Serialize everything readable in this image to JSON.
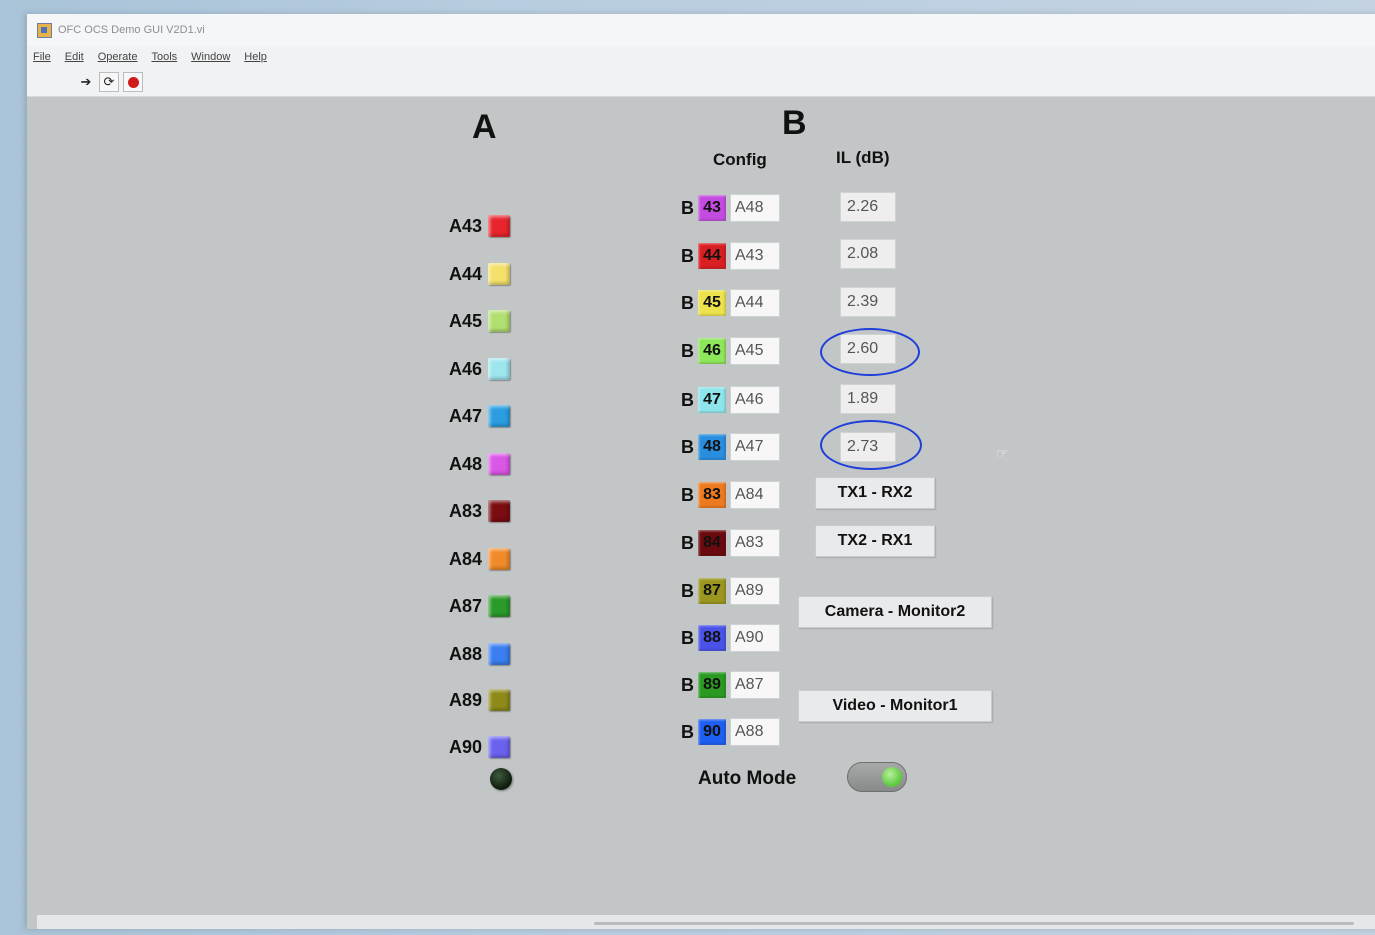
{
  "window": {
    "title": "OFC OCS Demo GUI V2D1.vi",
    "menu": [
      "File",
      "Edit",
      "Operate",
      "Tools",
      "Window",
      "Help"
    ],
    "toolbar": [
      "run-arrow-icon",
      "run-continuously-icon",
      "abort-icon"
    ]
  },
  "headers": {
    "a": "A",
    "b": "B",
    "config": "Config",
    "il": "IL (dB)"
  },
  "a_ports": [
    {
      "label": "A43",
      "color": "#e8242c"
    },
    {
      "label": "A44",
      "color": "#f4e06a"
    },
    {
      "label": "A45",
      "color": "#b2e070"
    },
    {
      "label": "A46",
      "color": "#9ee6ee"
    },
    {
      "label": "A47",
      "color": "#2a9ee0"
    },
    {
      "label": "A48",
      "color": "#da56e6"
    },
    {
      "label": "A83",
      "color": "#7a0c12"
    },
    {
      "label": "A84",
      "color": "#f08a2a"
    },
    {
      "label": "A87",
      "color": "#2a9a2a"
    },
    {
      "label": "A88",
      "color": "#3a7ef0"
    },
    {
      "label": "A89",
      "color": "#8e8a1a"
    },
    {
      "label": "A90",
      "color": "#6a62ee"
    }
  ],
  "b_letter": "B",
  "b_ports": [
    {
      "num": "43",
      "color": "#c34be0",
      "config": "A48"
    },
    {
      "num": "44",
      "color": "#d81f22",
      "config": "A43"
    },
    {
      "num": "45",
      "color": "#ece24c",
      "config": "A44"
    },
    {
      "num": "46",
      "color": "#8ee65a",
      "config": "A45"
    },
    {
      "num": "47",
      "color": "#8ee6ec",
      "config": "A46"
    },
    {
      "num": "48",
      "color": "#2a8ee0",
      "config": "A47"
    },
    {
      "num": "83",
      "color": "#ee7a20",
      "config": "A84"
    },
    {
      "num": "84",
      "color": "#6a0a0e",
      "config": "A83"
    },
    {
      "num": "87",
      "color": "#9a961e",
      "config": "A89"
    },
    {
      "num": "88",
      "color": "#4a52ea",
      "config": "A90"
    },
    {
      "num": "89",
      "color": "#2a9a22",
      "config": "A87"
    },
    {
      "num": "90",
      "color": "#1e5ef0",
      "config": "A88"
    }
  ],
  "il_values": [
    "2.26",
    "2.08",
    "2.39",
    "2.60",
    "1.89",
    "2.73"
  ],
  "buttons": {
    "tx1_rx2": "TX1 - RX2",
    "tx2_rx1": "TX2 - RX1",
    "camera_monitor2": "Camera - Monitor2",
    "video_monitor1": "Video - Monitor1"
  },
  "auto_mode": {
    "label": "Auto Mode",
    "on": true
  }
}
